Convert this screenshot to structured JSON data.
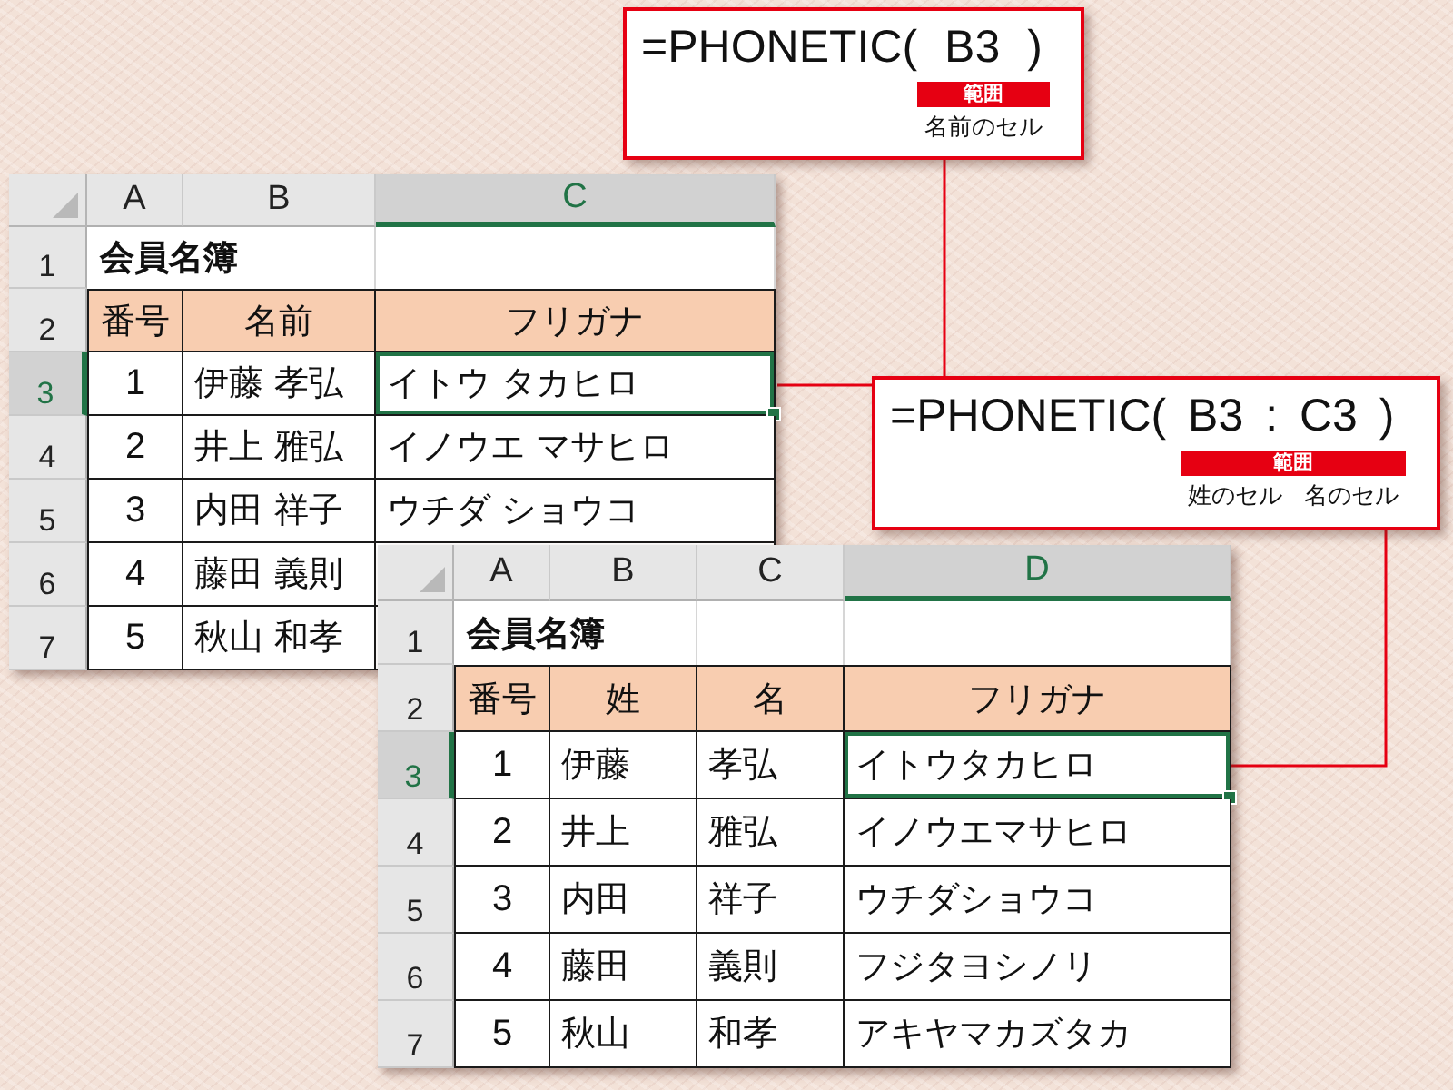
{
  "callouts": [
    {
      "formula": "=PHONETIC( B3 )",
      "range_label": "範囲",
      "captions": [
        "名前のセル"
      ]
    },
    {
      "formula": "=PHONETIC( B3 : C3 )",
      "range_label": "範囲",
      "captions": [
        "姓のセル",
        "名のセル"
      ]
    }
  ],
  "sheets": [
    {
      "column_headers": [
        {
          "label": "A",
          "selected": false
        },
        {
          "label": "B",
          "selected": false
        },
        {
          "label": "C",
          "selected": true
        }
      ],
      "title_row": {
        "number": "1",
        "selected": false,
        "title": "会員名簿"
      },
      "header_row": {
        "number": "2",
        "selected": false,
        "cells": [
          "番号",
          "名前",
          "フリガナ"
        ]
      },
      "data_rows": [
        {
          "number": "3",
          "selected": true,
          "cells": [
            {
              "text": "1",
              "selected": false
            },
            {
              "text": "伊藤 孝弘",
              "selected": false
            },
            {
              "text": "イトウ タカヒロ",
              "selected": true
            }
          ]
        },
        {
          "number": "4",
          "selected": false,
          "cells": [
            {
              "text": "2",
              "selected": false
            },
            {
              "text": "井上 雅弘",
              "selected": false
            },
            {
              "text": "イノウエ マサヒロ",
              "selected": false
            }
          ]
        },
        {
          "number": "5",
          "selected": false,
          "cells": [
            {
              "text": "3",
              "selected": false
            },
            {
              "text": "内田 祥子",
              "selected": false
            },
            {
              "text": "ウチダ ショウコ",
              "selected": false
            }
          ]
        },
        {
          "number": "6",
          "selected": false,
          "cells": [
            {
              "text": "4",
              "selected": false
            },
            {
              "text": "藤田 義則",
              "selected": false
            }
          ]
        },
        {
          "number": "7",
          "selected": false,
          "cells": [
            {
              "text": "5",
              "selected": false
            },
            {
              "text": "秋山 和孝",
              "selected": false
            }
          ]
        }
      ]
    },
    {
      "column_headers": [
        {
          "label": "A",
          "selected": false
        },
        {
          "label": "B",
          "selected": false
        },
        {
          "label": "C",
          "selected": false
        },
        {
          "label": "D",
          "selected": true
        }
      ],
      "title_row": {
        "number": "1",
        "selected": false,
        "title": "会員名簿"
      },
      "header_row": {
        "number": "2",
        "selected": false,
        "cells": [
          "番号",
          "姓",
          "名",
          "フリガナ"
        ]
      },
      "data_rows": [
        {
          "number": "3",
          "selected": true,
          "cells": [
            {
              "text": "1",
              "selected": false
            },
            {
              "text": "伊藤",
              "selected": false
            },
            {
              "text": "孝弘",
              "selected": false
            },
            {
              "text": "イトウタカヒロ",
              "selected": true
            }
          ]
        },
        {
          "number": "4",
          "selected": false,
          "cells": [
            {
              "text": "2",
              "selected": false
            },
            {
              "text": "井上",
              "selected": false
            },
            {
              "text": "雅弘",
              "selected": false
            },
            {
              "text": "イノウエマサヒロ",
              "selected": false
            }
          ]
        },
        {
          "number": "5",
          "selected": false,
          "cells": [
            {
              "text": "3",
              "selected": false
            },
            {
              "text": "内田",
              "selected": false
            },
            {
              "text": "祥子",
              "selected": false
            },
            {
              "text": "ウチダショウコ",
              "selected": false
            }
          ]
        },
        {
          "number": "6",
          "selected": false,
          "cells": [
            {
              "text": "4",
              "selected": false
            },
            {
              "text": "藤田",
              "selected": false
            },
            {
              "text": "義則",
              "selected": false
            },
            {
              "text": "フジタヨシノリ",
              "selected": false
            }
          ]
        },
        {
          "number": "7",
          "selected": false,
          "cells": [
            {
              "text": "5",
              "selected": false
            },
            {
              "text": "秋山",
              "selected": false
            },
            {
              "text": "和孝",
              "selected": false
            },
            {
              "text": "アキヤマカズタカ",
              "selected": false
            }
          ]
        }
      ]
    }
  ]
}
